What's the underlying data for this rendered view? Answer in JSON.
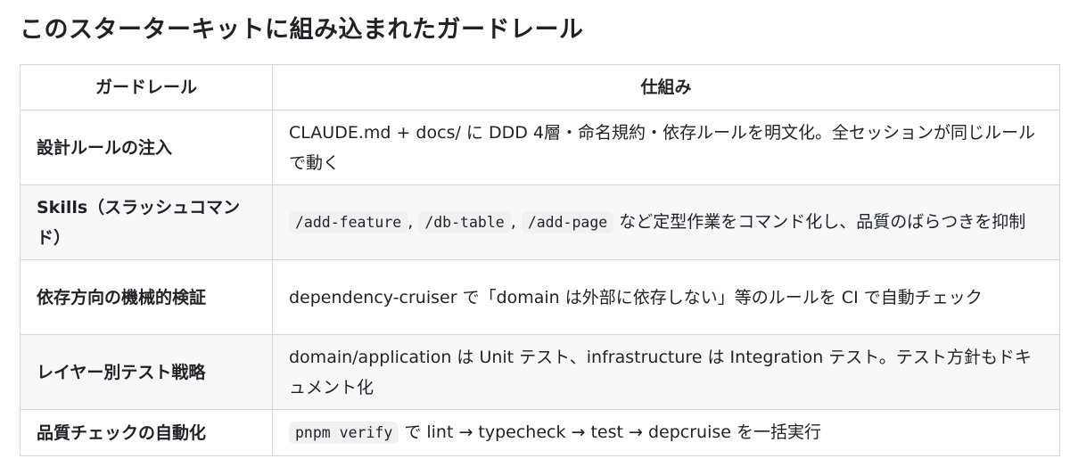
{
  "title": "このスターターキットに組み込まれたガードレール",
  "table": {
    "headers": [
      "ガードレール",
      "仕組み"
    ],
    "rows": [
      {
        "name": "設計ルールの注入",
        "desc_text": "CLAUDE.md + docs/ に DDD 4層・命名規約・依存ルールを明文化。全セッションが同じルールで動く"
      },
      {
        "name": "Skills（スラッシュコマンド）",
        "code1": "/add-feature",
        "sep1": ", ",
        "code2": "/db-table",
        "sep2": ", ",
        "code3": "/add-page",
        "desc_text": " など定型作業をコマンド化し、品質のばらつきを抑制"
      },
      {
        "name": "依存方向の機械的検証",
        "desc_text": "dependency-cruiser で「domain は外部に依存しない」等のルールを CI で自動チェック"
      },
      {
        "name": "レイヤー別テスト戦略",
        "desc_text": "domain/application は Unit テスト、infrastructure は Integration テスト。テスト方針もドキュメント化"
      },
      {
        "name": "品質チェックの自動化",
        "code1": "pnpm verify",
        "desc_text": " で lint → typecheck → test → depcruise を一括実行"
      }
    ]
  }
}
